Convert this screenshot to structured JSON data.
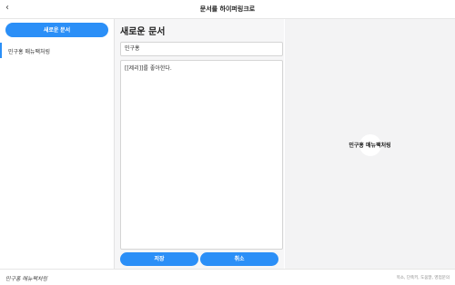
{
  "header": {
    "back_glyph": "‹",
    "title": "문서를 하이퍼링크로"
  },
  "sidebar": {
    "new_button_label": "새로운 문서",
    "items": [
      {
        "label": "민구홍 매뉴팩처링"
      }
    ]
  },
  "editor": {
    "heading": "새로운 문서",
    "name_value": "민구홍",
    "content_value": "[[제리]]를 좋아한다.",
    "save_label": "저장",
    "cancel_label": "취소"
  },
  "preview": {
    "node_label": "민구홍 매뉴팩처링"
  },
  "footer": {
    "logo_text": "민구홍 매뉴팩처링",
    "links_text": "목소, 단축키, 도움말, 영업문의"
  },
  "colors": {
    "accent": "#2b8ff7"
  }
}
